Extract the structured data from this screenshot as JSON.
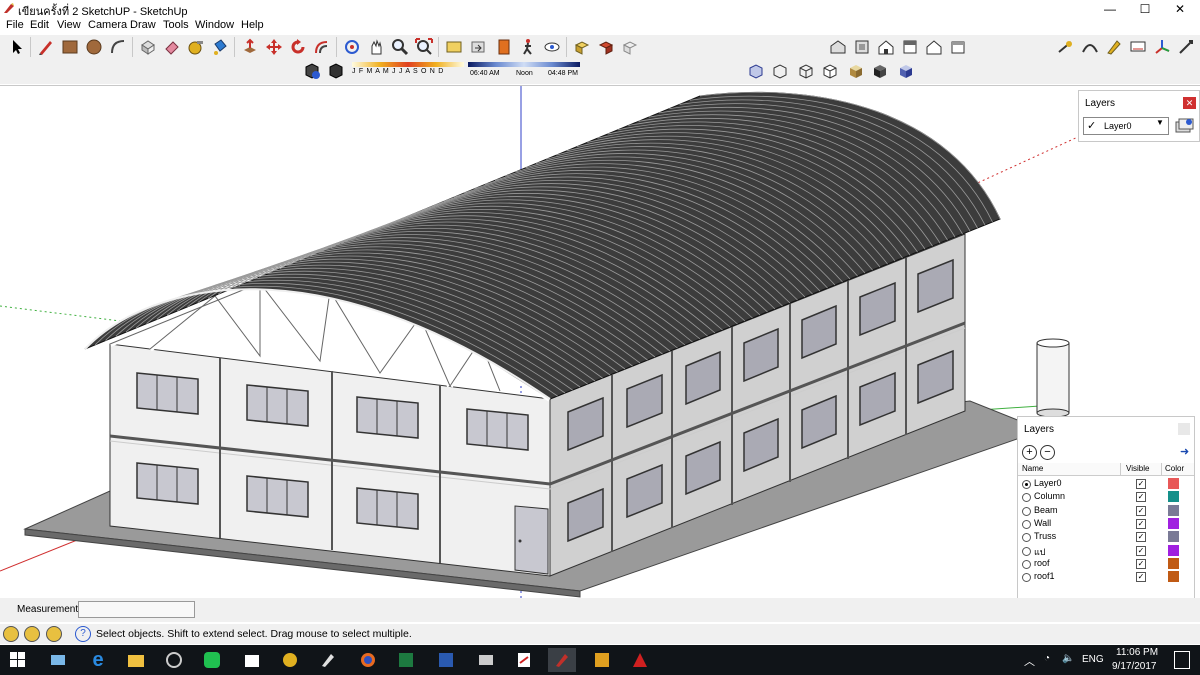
{
  "window": {
    "title": "เขียนครั้งที่ 2 SketchUP - SketchUp",
    "minimize": "—",
    "maximize": "☐",
    "close": "✕"
  },
  "menu": [
    "File",
    "Edit",
    "View",
    "Camera",
    "Draw",
    "Tools",
    "Window",
    "Help"
  ],
  "shadows": {
    "months": "J F M A M J J A S O N D",
    "time_start": "06:40 AM",
    "time_noon": "Noon",
    "time_end": "04:48 PM"
  },
  "layers_toolbar": {
    "title": "Layers",
    "current_layer": "Layer0",
    "check": "✓"
  },
  "layers_panel": {
    "title": "Layers",
    "col_name": "Name",
    "col_visible": "Visible",
    "col_color": "Color",
    "rows": [
      {
        "name": "Layer0",
        "visible": true,
        "color": "#e85858",
        "selected": true
      },
      {
        "name": "Column",
        "visible": true,
        "color": "#15908a",
        "selected": false
      },
      {
        "name": "Beam",
        "visible": true,
        "color": "#7a7a96",
        "selected": false
      },
      {
        "name": "Wall",
        "visible": true,
        "color": "#a020e0",
        "selected": false
      },
      {
        "name": "Truss",
        "visible": true,
        "color": "#7a7a96",
        "selected": false
      },
      {
        "name": "แป",
        "visible": true,
        "color": "#a020e0",
        "selected": false
      },
      {
        "name": "roof",
        "visible": true,
        "color": "#c05a14",
        "selected": false
      },
      {
        "name": "roof1",
        "visible": true,
        "color": "#c05a14",
        "selected": false
      }
    ]
  },
  "measurements": {
    "label": "Measurements",
    "value": ""
  },
  "status": {
    "hint": "Select objects. Shift to extend select. Drag mouse to select multiple."
  },
  "taskbar": {
    "lang": "ENG",
    "time": "11:06 PM",
    "date": "9/17/2017"
  },
  "icons": [
    "select-icon",
    "pencil-icon",
    "rectangle-icon",
    "circle-icon",
    "arc-icon",
    "eraser-icon",
    "paint-icon",
    "push-pull-icon",
    "move-icon",
    "rotate-icon",
    "offset-icon",
    "orbit-icon",
    "pan-icon",
    "zoom-icon",
    "zoom-extents-icon"
  ]
}
